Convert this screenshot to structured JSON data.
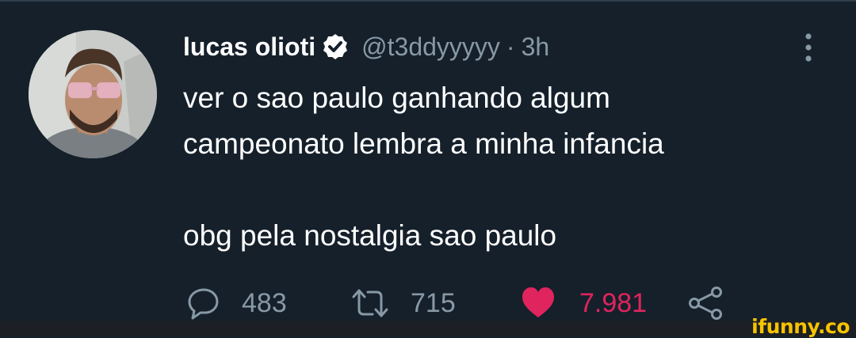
{
  "tweet": {
    "author": {
      "name": "lucas olioti",
      "handle": "@t3ddyyyyy",
      "separator": "·",
      "time": "3h"
    },
    "text": "ver o sao paulo ganhando algum\ncampeonato lembra a minha infancia\n\nobg pela nostalgia sao paulo",
    "stats": {
      "replies": "483",
      "retweets": "715",
      "likes": "7.981"
    }
  },
  "icons": {
    "verified": "verified-badge-icon",
    "more": "more-vertical-icon",
    "reply": "reply-icon",
    "retweet": "retweet-icon",
    "like": "heart-icon",
    "share": "share-icon"
  },
  "colors": {
    "background": "#15202b",
    "secondary_text": "#8899a6",
    "like_red": "#e0245e",
    "watermark_yellow": "#f7c300"
  },
  "watermark": "ifunny.co"
}
